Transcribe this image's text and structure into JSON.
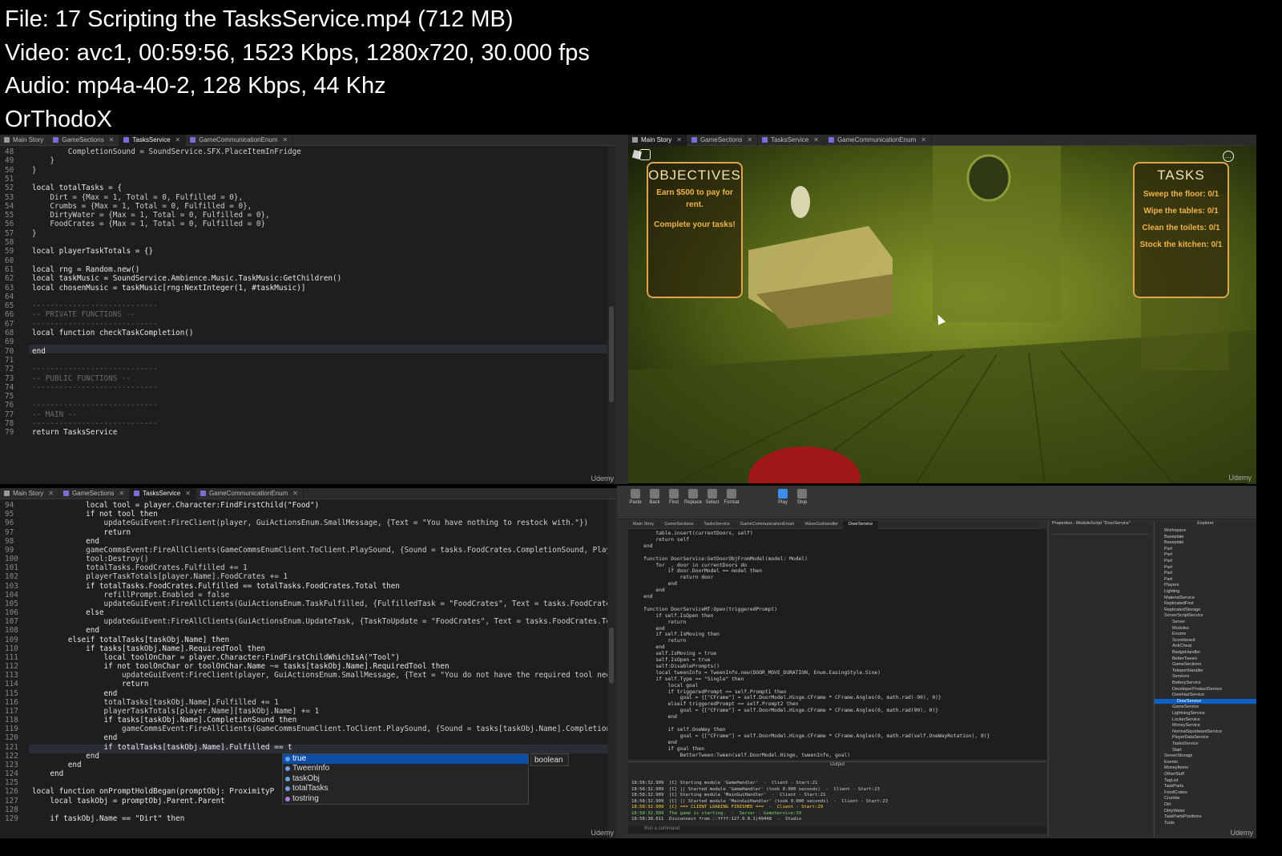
{
  "header": {
    "file": "File: 17  Scripting the TasksService.mp4 (712 MB)",
    "video": "Video: avc1, 00:59:56, 1523 Kbps, 1280x720, 30.000 fps",
    "audio": "Audio: mp4a-40-2, 128 Kbps, 44 Khz",
    "author": "OrThodoX"
  },
  "tabs": {
    "main_story": "Main Story",
    "game_sections": "GameSections",
    "tasks_service": "TasksService",
    "game_comm_enum": "GameCommunicationEnum"
  },
  "top_editor": {
    "lines": [
      {
        "n": "48",
        "text": "        CompletionSound = SoundService.SFX.PlaceItemInFridge"
      },
      {
        "n": "49",
        "text": "    }"
      },
      {
        "n": "50",
        "text": "}"
      },
      {
        "n": "51",
        "text": ""
      },
      {
        "n": "52",
        "text": "local totalTasks = {"
      },
      {
        "n": "53",
        "text": "    Dirt = {Max = 1, Total = 0, Fulfilled = 0},"
      },
      {
        "n": "54",
        "text": "    Crumbs = {Max = 1, Total = 0, Fulfilled = 0},"
      },
      {
        "n": "55",
        "text": "    DirtyWater = {Max = 1, Total = 0, Fulfilled = 0},"
      },
      {
        "n": "56",
        "text": "    FoodCrates = {Max = 1, Total = 0, Fulfilled = 0}"
      },
      {
        "n": "57",
        "text": "}"
      },
      {
        "n": "58",
        "text": ""
      },
      {
        "n": "59",
        "text": "local playerTaskTotals = {}"
      },
      {
        "n": "60",
        "text": ""
      },
      {
        "n": "61",
        "text": "local rng = Random.new()"
      },
      {
        "n": "62",
        "text": "local taskMusic = SoundService.Ambience.Music.TaskMusic:GetChildren()"
      },
      {
        "n": "63",
        "text": "local chosenMusic = taskMusic[rng:NextInteger(1, #taskMusic)]"
      },
      {
        "n": "64",
        "text": ""
      },
      {
        "n": "65",
        "text": "----------------------------"
      },
      {
        "n": "66",
        "text": "-- PRIVATE FUNCTIONS --"
      },
      {
        "n": "67",
        "text": "----------------------------"
      },
      {
        "n": "68",
        "text": "local function checkTaskCompletion()"
      },
      {
        "n": "69",
        "text": ""
      },
      {
        "n": "70",
        "text": "end"
      },
      {
        "n": "71",
        "text": ""
      },
      {
        "n": "72",
        "text": "----------------------------"
      },
      {
        "n": "73",
        "text": "-- PUBLIC FUNCTIONS --"
      },
      {
        "n": "74",
        "text": "----------------------------"
      },
      {
        "n": "75",
        "text": ""
      },
      {
        "n": "76",
        "text": "----------------------------"
      },
      {
        "n": "77",
        "text": "-- MAIN --"
      },
      {
        "n": "78",
        "text": "----------------------------"
      },
      {
        "n": "79",
        "text": "return TasksService"
      }
    ]
  },
  "bottom_editor": {
    "lines": [
      {
        "n": "94",
        "text": "            local tool = player.Character:FindFirstChild(\"Food\")"
      },
      {
        "n": "95",
        "text": "            if not tool then"
      },
      {
        "n": "96",
        "text": "                updateGuiEvent:FireClient(player, GuiActionsEnum.SmallMessage, {Text = \"You have nothing to restock with.\"})"
      },
      {
        "n": "97",
        "text": "                return"
      },
      {
        "n": "98",
        "text": "            end"
      },
      {
        "n": "99",
        "text": "            gameCommsEvent:FireAllClients(GameCommsEnumClient.ToClient.PlaySound, {Sound = tasks.FoodCrates.CompletionSound, PlayA"
      },
      {
        "n": "100",
        "text": "            tool:Destroy()"
      },
      {
        "n": "101",
        "text": "            totalTasks.FoodCrates.Fulfilled += 1"
      },
      {
        "n": "102",
        "text": "            playerTaskTotals[player.Name].FoodCrates += 1"
      },
      {
        "n": "103",
        "text": "            if totalTasks.FoodCrates.Fulfilled == totalTasks.FoodCrates.Total then"
      },
      {
        "n": "104",
        "text": "                refillPrompt.Enabled = false"
      },
      {
        "n": "105",
        "text": "                updateGuiEvent:FireAllClients(GuiActionsEnum.TaskFulfilled, {FulfilledTask = \"FoodCrates\", Text = tasks.FoodCrates"
      },
      {
        "n": "106",
        "text": "            else"
      },
      {
        "n": "107",
        "text": "                updateGuiEvent:FireAllClients(GuiActionsEnum.UpdateTask, {TaskToUpdate = \"FoodCrates\", Text = tasks.FoodCrates.Tex"
      },
      {
        "n": "108",
        "text": "            end"
      },
      {
        "n": "109",
        "text": "        elseif totalTasks[taskObj.Name] then"
      },
      {
        "n": "110",
        "text": "            if tasks[taskObj.Name].RequiredTool then"
      },
      {
        "n": "111",
        "text": "                local toolOnChar = player.Character:FindFirstChildWhichIsA(\"Tool\")"
      },
      {
        "n": "112",
        "text": "                if not toolOnChar or toolOnChar.Name ~= tasks[taskObj.Name].RequiredTool then"
      },
      {
        "n": "113",
        "text": "                    updateGuiEvent:FireClient(player, GuiActionsEnum.SmallMessage, {Text = \"You do not have the required tool need"
      },
      {
        "n": "114",
        "text": "                    return"
      },
      {
        "n": "115",
        "text": "                end"
      },
      {
        "n": "116",
        "text": "                totalTasks[taskObj.Name].Fulfilled += 1"
      },
      {
        "n": "117",
        "text": "                playerTaskTotals[player.Name][taskObj.Name] += 1"
      },
      {
        "n": "118",
        "text": "                if tasks[taskObj.Name].CompletionSound then"
      },
      {
        "n": "119",
        "text": "                    gameCommsEvent:FireAllClients(GameCommsEnumClient.ToClient.PlaySound, {Sound = tasks[taskObj.Name].CompletionS"
      },
      {
        "n": "120",
        "text": "                end"
      },
      {
        "n": "121",
        "text": "                if totalTasks[taskObj.Name].Fulfilled == t"
      },
      {
        "n": "122",
        "text": "            end"
      },
      {
        "n": "123",
        "text": "        end"
      },
      {
        "n": "124",
        "text": "    end"
      },
      {
        "n": "125",
        "text": ""
      },
      {
        "n": "126",
        "text": "local function onPromptHoldBegan(promptObj: ProximityP"
      },
      {
        "n": "127",
        "text": "    local taskObj = promptObj.Parent.Parent"
      },
      {
        "n": "128",
        "text": ""
      },
      {
        "n": "129",
        "text": "    if taskObj.Name == \"Dirt\" then"
      }
    ]
  },
  "autocomplete": {
    "items": [
      "true",
      "TweenInfo",
      "taskObj",
      "totalTasks",
      "tostring"
    ],
    "type_hint": "boolean"
  },
  "game": {
    "objectives_title": "OBJECTIVES",
    "objective_1": "Earn $500 to pay for rent.",
    "objective_2": "Complete your tasks!",
    "tasks_title": "TASKS",
    "tasks": [
      "Sweep the floor: 0/1",
      "Wipe the tables: 0/1",
      "Clean the toilets: 0/1",
      "Stock the kitchen: 0/1"
    ]
  },
  "watermark": "Udemy",
  "studio": {
    "ribbon": [
      "Paste",
      "Back",
      "Find",
      "Replace",
      "Select",
      "Format",
      "Play",
      "Stop"
    ],
    "tabs": [
      "Main Story",
      "GameSections",
      "TasksService",
      "GameCommunicationEnum",
      "WaveGuiHandler",
      "DoorService"
    ],
    "code": [
      "        table.insert(currentDoors, self)",
      "        return self",
      "    end",
      "",
      "    function DoorService:GetDoorObjFromModel(model: Model)",
      "        for _, door in currentDoors do",
      "            if door.DoorModel == model then",
      "                return door",
      "            end",
      "        end",
      "    end",
      "",
      "    function DoorServiceMT:Open(triggeredPrompt)",
      "        if self.IsOpen then",
      "            return",
      "        end",
      "        if self.IsMoving then",
      "            return",
      "        end",
      "        self.IsMoving = true",
      "        self.IsOpen = true",
      "        self:DisablePrompts()",
      "        local tweenInfo = TweenInfo.new(DOOR_MOVE_DURATION, Enum.EasingStyle.Sine)",
      "        if self.Type == \"Single\" then",
      "            local goal",
      "            if triggeredPrompt == self.Prompt1 then",
      "                goal = {[\"CFrame\"] = self.DoorModel.Hinge.CFrame * CFrame.Angles(0, math.rad(-90), 0)}",
      "            elseif triggeredPrompt == self.Prompt2 then",
      "                goal = {[\"CFrame\"] = self.DoorModel.Hinge.CFrame * CFrame.Angles(0, math.rad(90), 0)}",
      "            end",
      "",
      "            if self.OneWay then",
      "                goal = {[\"CFrame\"] = self.DoorModel.Hinge.CFrame * CFrame.Angles(0, math.rad(self.OneWayRotation), 0)}",
      "            end",
      "            if goal then",
      "                BetterTween:Tween(self.DoorModel.Hinge, tweenInfo, goal)"
    ],
    "output_title": "Output",
    "output_lines": [
      "18:58:32.909  [C] Starting module 'GameHandler'  -  Client - Start:21",
      "18:58:32.909  [C] || Started module 'GameHandler' (took 0.000 seconds)  -  Client - Start:23",
      "18:58:32.909  [C] Starting module 'MainGuiHandler'  -  Client - Start:21",
      "18:58:32.909  [C] || Started module 'MainGuiHandler' (took 0.000 seconds)  -  Client - Start:23",
      "18:58:32.909  [C] === CLIENT LOADING FINISHED ===  -  Client - Start:29",
      "18:58:32.909  The game is starting.  -  Server - GameService:39",
      "18:58:38.011  Disconnect from ::ffff:127.0.0.1|49448  -  Studio"
    ],
    "command_placeholder": "Run a command",
    "properties_title": "Properties - ModuleScript \"DoorService\"",
    "explorer_title": "Explorer",
    "explorer_items": [
      "Workspace",
      "Baseplate",
      "Baseplate",
      "Part",
      "Part",
      "Part",
      "Part",
      "Part",
      "Part",
      "Players",
      "Lighting",
      "MaterialService",
      "ReplicatedFirst",
      "ReplicatedStorage",
      "ServerScriptService",
      "Server",
      "Modules",
      "Enums",
      "Scoreboard",
      "AntiCheat",
      "BadgeHandler",
      "BetterTween",
      "GameSections",
      "TeleportHandler",
      "Services",
      "BatteryService",
      "DeveloperProductService",
      "DoorHazService",
      "DoorService",
      "GameService",
      "LightningService",
      "LockerService",
      "MoneyService",
      "NormalSquidwardService",
      "PlayerDataService",
      "TasksService",
      "Start",
      "ServerStorage",
      "Events",
      "MoneyItems",
      "OtherStuff",
      "TagList",
      "TaskParts",
      "FoodCrates",
      "Crumbs",
      "Dirt",
      "DirtyWater",
      "TaskPartsPositions",
      "Tools"
    ]
  }
}
